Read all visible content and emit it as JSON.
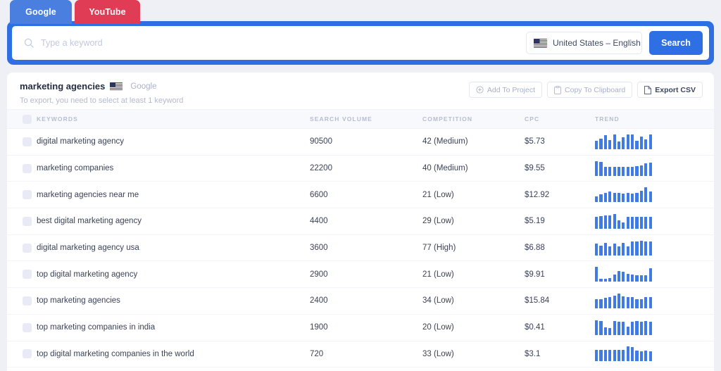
{
  "tabs": [
    {
      "label": "Google",
      "active": true,
      "color": "#4a7fe0"
    },
    {
      "label": "YouTube",
      "active": false,
      "color": "#e03c56"
    }
  ],
  "search": {
    "placeholder": "Type a keyword",
    "value": "",
    "icon": "search-icon",
    "locale": "United States – English",
    "locale_flag": "us-flag-icon",
    "button_label": "Search",
    "accent_color": "#2f6fe4"
  },
  "results": {
    "keyword_title": "marketing agencies",
    "source_flag": "us-flag-icon",
    "source_name": "Google",
    "hint": "To export, you need to select at least 1 keyword",
    "actions": [
      {
        "label": "Add To Project",
        "icon": "plus-circle-icon",
        "emphasis": false
      },
      {
        "label": "Copy To Clipboard",
        "icon": "clipboard-icon",
        "emphasis": false
      },
      {
        "label": "Export CSV",
        "icon": "file-icon",
        "emphasis": true
      }
    ],
    "columns": [
      "KEYWORDS",
      "SEARCH VOLUME",
      "COMPETITION",
      "CPC",
      "TREND"
    ],
    "rows": [
      {
        "keyword": "digital marketing agency",
        "volume": "90500",
        "competition": "42 (Medium)",
        "cpc": "$5.73",
        "trend": [
          55,
          70,
          95,
          62,
          100,
          52,
          80,
          100,
          98,
          58,
          86,
          64,
          100
        ]
      },
      {
        "keyword": "marketing companies",
        "volume": "22200",
        "competition": "40 (Medium)",
        "cpc": "$9.55",
        "trend": [
          100,
          95,
          62,
          60,
          62,
          60,
          62,
          60,
          62,
          64,
          70,
          82,
          88
        ]
      },
      {
        "keyword": "marketing agencies near me",
        "volume": "6600",
        "competition": "21 (Low)",
        "cpc": "$12.92",
        "trend": [
          38,
          52,
          62,
          74,
          64,
          62,
          60,
          62,
          60,
          64,
          78,
          100,
          74
        ]
      },
      {
        "keyword": "best digital marketing agency",
        "volume": "4400",
        "competition": "29 (Low)",
        "cpc": "$5.19",
        "trend": [
          82,
          86,
          88,
          90,
          100,
          56,
          42,
          80,
          82,
          80,
          82,
          80,
          82
        ]
      },
      {
        "keyword": "digital marketing agency usa",
        "volume": "3600",
        "competition": "77 (High)",
        "cpc": "$6.88",
        "trend": [
          78,
          66,
          84,
          58,
          80,
          60,
          86,
          62,
          92,
          94,
          96,
          92,
          94
        ]
      },
      {
        "keyword": "top digital marketing agency",
        "volume": "2900",
        "competition": "21 (Low)",
        "cpc": "$9.91",
        "trend": [
          100,
          22,
          22,
          26,
          50,
          72,
          70,
          52,
          48,
          46,
          44,
          46,
          90
        ]
      },
      {
        "keyword": "top marketing agencies",
        "volume": "2400",
        "competition": "34 (Low)",
        "cpc": "$15.84",
        "trend": [
          60,
          64,
          72,
          78,
          84,
          100,
          80,
          78,
          76,
          62,
          60,
          74,
          78
        ]
      },
      {
        "keyword": "top marketing companies in india",
        "volume": "1900",
        "competition": "20 (Low)",
        "cpc": "$0.41",
        "trend": [
          100,
          96,
          52,
          48,
          92,
          90,
          88,
          56,
          90,
          92,
          90,
          92,
          90
        ]
      },
      {
        "keyword": "top digital marketing companies in the world",
        "volume": "720",
        "competition": "33 (Low)",
        "cpc": "$3.1",
        "trend": [
          80,
          78,
          80,
          78,
          80,
          78,
          80,
          100,
          96,
          72,
          70,
          72,
          70
        ]
      }
    ]
  }
}
